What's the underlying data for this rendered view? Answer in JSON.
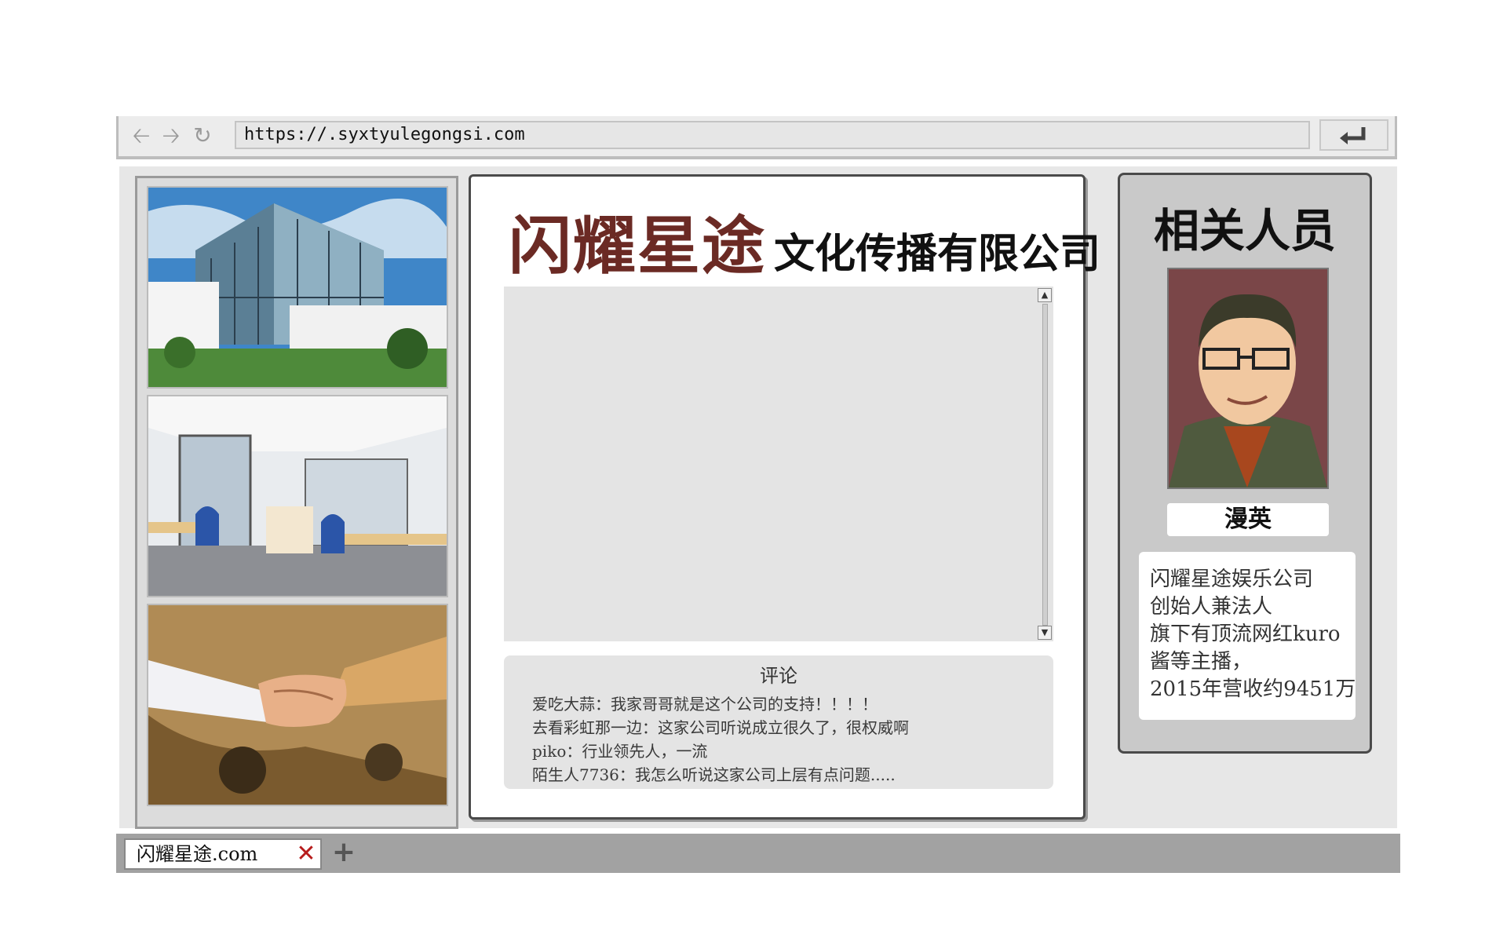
{
  "browser": {
    "url": "https://.syxtyulegongsi.com",
    "back_icon": "arrow-left-icon",
    "forward_icon": "arrow-right-icon",
    "reload_icon": "reload-icon",
    "go_icon": "enter-icon"
  },
  "gallery": {
    "photos": [
      {
        "icon": "office-building-photo"
      },
      {
        "icon": "office-interior-photo"
      },
      {
        "icon": "handshake-photo"
      }
    ]
  },
  "company": {
    "brand": "闪耀星途",
    "rest": "文化传播有限公司",
    "brand_color": "#6b2a24"
  },
  "comments": {
    "title": "评论",
    "items": [
      "爱吃大蒜：我家哥哥就是这个公司的支持！！！！",
      "去看彩虹那一边：这家公司听说成立很久了，很权威啊",
      "piko：行业领先人，一流",
      "陌生人7736：我怎么听说这家公司上层有点问题....."
    ]
  },
  "person": {
    "heading": "相关人员",
    "name": "漫英",
    "bio": [
      "闪耀星途娱乐公司",
      "创始人兼法人",
      "旗下有顶流网红kuro",
      "酱等主播，",
      "2015年营收约9451万"
    ]
  },
  "tabs": {
    "active_label": "闪耀星途.com",
    "close_color": "#b71c1c"
  }
}
